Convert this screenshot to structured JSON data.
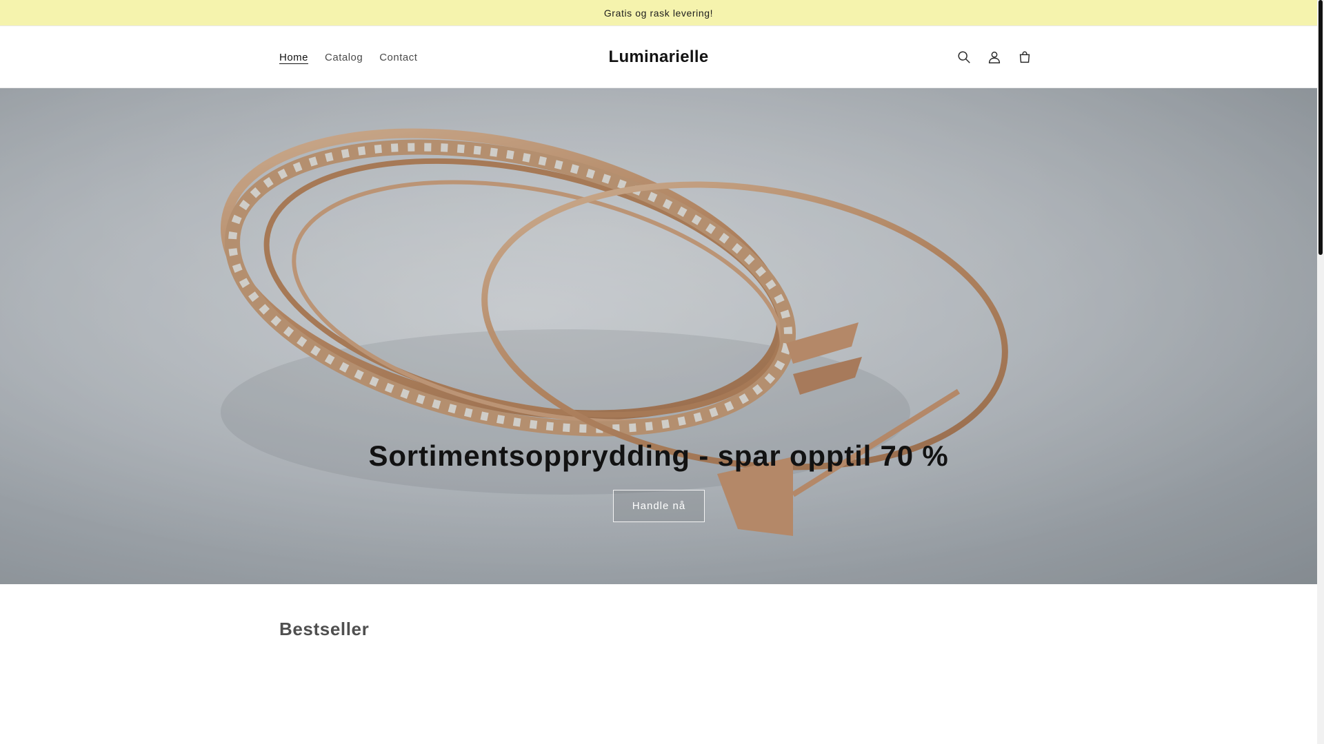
{
  "announcement": {
    "text": "Gratis og rask levering!"
  },
  "header": {
    "nav": [
      {
        "label": "Home",
        "active": true
      },
      {
        "label": "Catalog",
        "active": false
      },
      {
        "label": "Contact",
        "active": false
      }
    ],
    "logo": "Luminarielle",
    "icons": [
      "search-icon",
      "account-icon",
      "cart-icon"
    ]
  },
  "hero": {
    "title": "Sortimentsopprydding - spar opptil 70 %",
    "button_label": "Handle nå"
  },
  "bestseller": {
    "title": "Bestseller"
  },
  "colors": {
    "announcement_bg": "#f5f3ad",
    "text": "#121212",
    "gold": "#c8926a"
  }
}
